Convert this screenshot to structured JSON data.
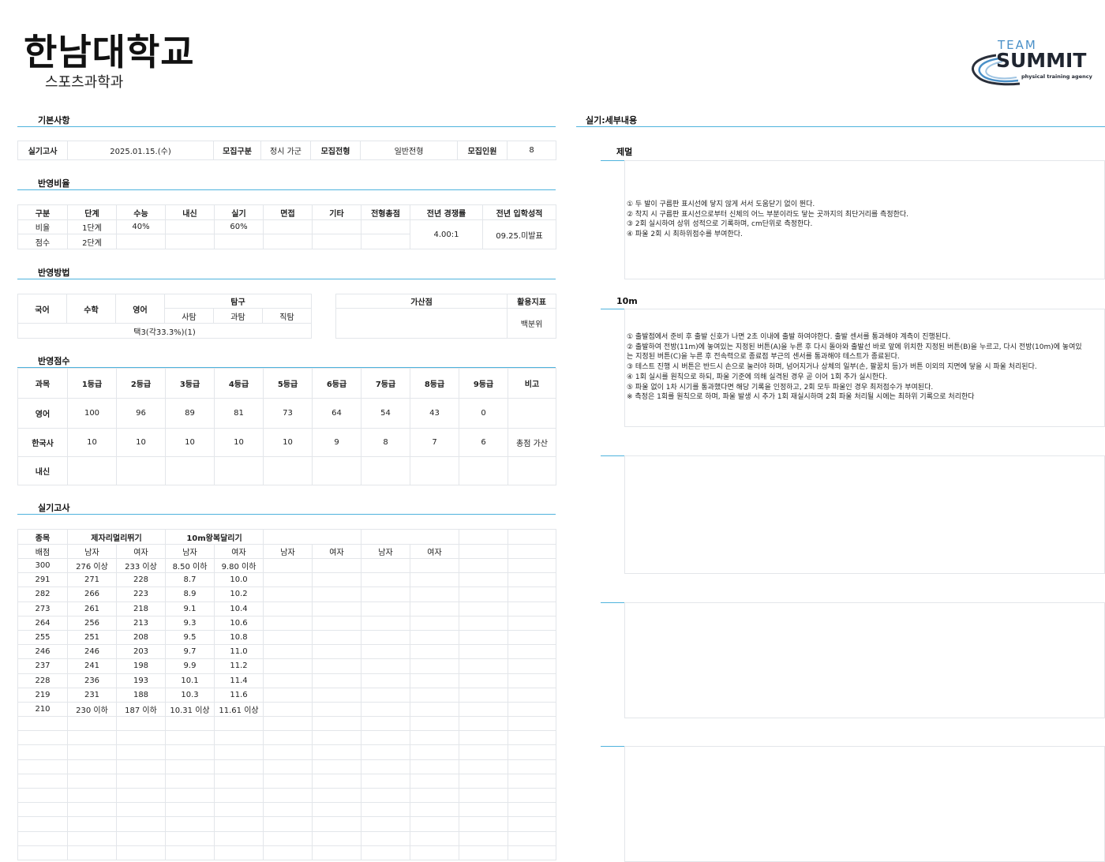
{
  "header": {
    "university": "한남대학교",
    "department": "스포츠과학과"
  },
  "logo": {
    "team": "TEAM",
    "summit": "SUMMIT",
    "tagline": "physical training agency",
    "accent": "#4a90c8"
  },
  "sections": {
    "basic": "기본사항",
    "ratio": "반영비율",
    "method": "반영방법",
    "score": "반영점수",
    "exam": "실기고사",
    "detail": "실기:세부내용"
  },
  "basic": {
    "exam_label": "실기고사",
    "exam_date": "2025.01.15.(수)",
    "type_label": "모집구분",
    "type_value": "정시 가군",
    "track_label": "모집전형",
    "track_value": "일반전형",
    "quota_label": "모집인원",
    "quota_value": "8"
  },
  "ratio": {
    "headers": [
      "구분",
      "단계",
      "수능",
      "내신",
      "실기",
      "면접",
      "기타",
      "전형총점",
      "전년 경쟁률",
      "전년 입학성적"
    ],
    "row1": [
      "비율",
      "1단계",
      "40%",
      "",
      "60%",
      "",
      "",
      ""
    ],
    "row2": [
      "점수",
      "2단계",
      "",
      "",
      "",
      "",
      "",
      ""
    ],
    "competition": "4.00:1",
    "prev_score": "09.25.미발표"
  },
  "method": {
    "korean": "국어",
    "math": "수학",
    "english": "영어",
    "inquiry": "탐구",
    "social": "사탐",
    "science": "과탐",
    "vocational": "직탐",
    "combo": "택3(각33.3%)(1)",
    "bonus": "가산점",
    "indicator": "활용지표",
    "indicator_value": "백분위"
  },
  "score": {
    "headers": [
      "과목",
      "1등급",
      "2등급",
      "3등급",
      "4등급",
      "5등급",
      "6등급",
      "7등급",
      "8등급",
      "9등급",
      "비고"
    ],
    "rows": [
      [
        "영어",
        "100",
        "96",
        "89",
        "81",
        "73",
        "64",
        "54",
        "43",
        "0",
        ""
      ],
      [
        "한국사",
        "10",
        "10",
        "10",
        "10",
        "10",
        "9",
        "8",
        "7",
        "6",
        "총점 가산"
      ],
      [
        "내신",
        "",
        "",
        "",
        "",
        "",
        "",
        "",
        "",
        "",
        ""
      ]
    ]
  },
  "exam": {
    "event_label": "종목",
    "points_label": "배점",
    "event1": "제자리멀리뛰기",
    "event2": "10m왕복달리기",
    "male": "남자",
    "female": "여자",
    "rows": [
      [
        "300",
        "276 이상",
        "233 이상",
        "8.50 이하",
        "9.80 이하"
      ],
      [
        "291",
        "271",
        "228",
        "8.7",
        "10.0"
      ],
      [
        "282",
        "266",
        "223",
        "8.9",
        "10.2"
      ],
      [
        "273",
        "261",
        "218",
        "9.1",
        "10.4"
      ],
      [
        "264",
        "256",
        "213",
        "9.3",
        "10.6"
      ],
      [
        "255",
        "251",
        "208",
        "9.5",
        "10.8"
      ],
      [
        "246",
        "246",
        "203",
        "9.7",
        "11.0"
      ],
      [
        "237",
        "241",
        "198",
        "9.9",
        "11.2"
      ],
      [
        "228",
        "236",
        "193",
        "10.1",
        "11.4"
      ],
      [
        "219",
        "231",
        "188",
        "10.3",
        "11.6"
      ],
      [
        "210",
        "230 이하",
        "187 이하",
        "10.31 이상",
        "11.61 이상"
      ]
    ]
  },
  "detail": {
    "jump_title": "제멀",
    "jump_text": "① 두 발이 구름판 표시선에 닿지 않게 서서 도움닫기 없이 뛴다.\n② 착지 시 구름판 표시선으로부터 신체의 어느 부분이라도 닿는 곳까지의 최단거리를 측정한다.\n③ 2회 실시하여 상위 성적으로 기록하며, cm단위로 측정한다.\n④ 파울 2회 시 최하위점수를 부여한다.",
    "run_title": "10m",
    "run_text": "① 출발점에서 준비 후 출발 신호가 나면 2초 이내에 출발 하여야한다. 출발 센서를 통과해야 계측이 진행된다.\n② 출발하여 전방(11m)에 놓여있는 지정된 버튼(A)을 누른 후 다시 돌아와 출발선 바로 앞에 위치한 지정된 버튼(B)을 누르고, 다시 전방(10m)에 놓여있\n는 지정된 버튼(C)을 누른 후 전속력으로 종료점 부근의 센서를 통과해야 테스트가 종료된다.\n③ 테스트 진행 시 버튼은 반드시 손으로 눌러야 하며, 넘어지거나 상체의 일부(손, 팔꿈치 등)가 버튼 이외의 지면에 닿을 시 파울 처리된다.\n④ 1회 실시를 원칙으로 하되, 파울 기준에 의해 실격된 경우 곧 이어 1회 추가 실시한다.\n⑤ 파울 없이 1차 시기를 통과했다면 해당 기록을 인정하고, 2회 모두 파울인 경우 최저점수가 부여된다.\n※ 측정은 1회를 원칙으로 하며, 파울 발생 시 추가 1회 재실시하며 2회 파울 처리될 시에는 최하위 기록으로 처리한다"
  }
}
